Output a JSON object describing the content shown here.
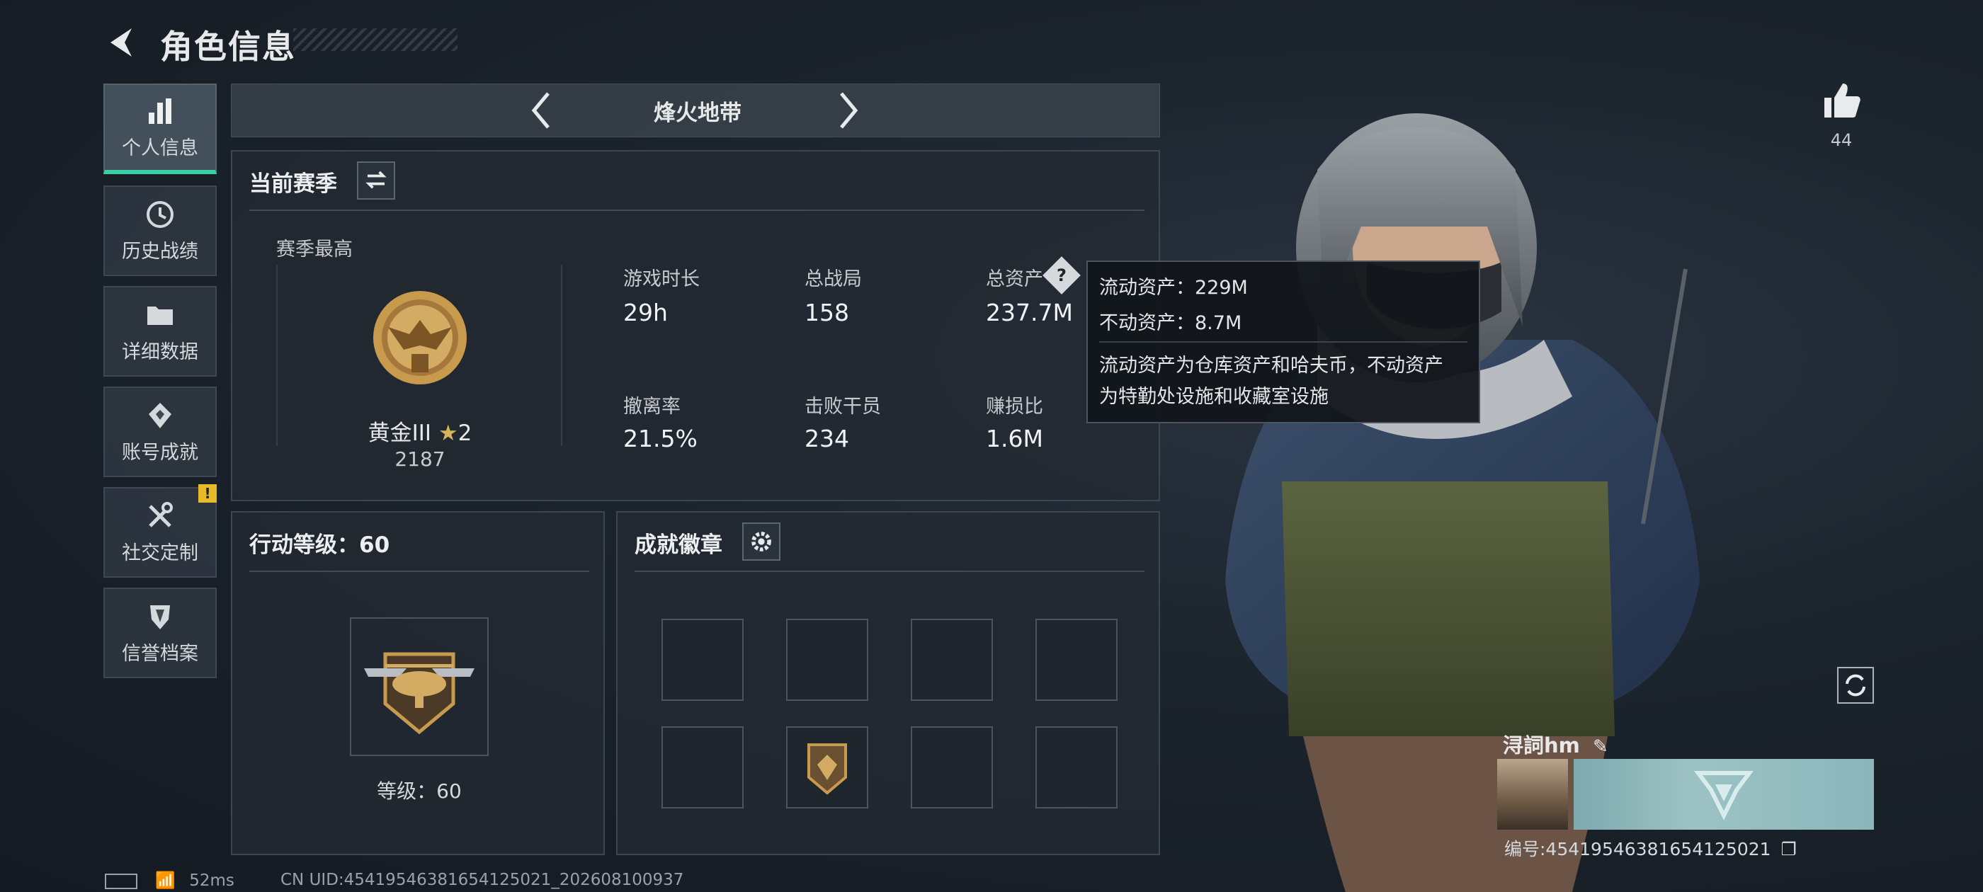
{
  "header": {
    "title": "角色信息"
  },
  "sidebar": {
    "items": [
      {
        "label": "个人信息",
        "icon": "bar-chart-icon",
        "active": true
      },
      {
        "label": "历史战绩",
        "icon": "history-icon"
      },
      {
        "label": "详细数据",
        "icon": "folder-icon"
      },
      {
        "label": "账号成就",
        "icon": "achievement-icon"
      },
      {
        "label": "社交定制",
        "icon": "tools-icon",
        "alert": "!"
      },
      {
        "label": "信誉档案",
        "icon": "shield-icon"
      }
    ]
  },
  "mode_tab": {
    "title": "烽火地带"
  },
  "season": {
    "title": "当前赛季",
    "best_label": "赛季最高",
    "rank": "黄金III",
    "rank_stars": "2",
    "rank_score": "2187",
    "stats": [
      {
        "label": "游戏时长",
        "value": "29h"
      },
      {
        "label": "总战局",
        "value": "158"
      },
      {
        "label": "总资产",
        "value": "237.7M"
      },
      {
        "label": "撤离率",
        "value": "21.5%"
      },
      {
        "label": "击败干员",
        "value": "234"
      },
      {
        "label": "赚损比",
        "value": "1.6M"
      }
    ]
  },
  "tooltip": {
    "line1": "流动资产：229M",
    "line2": "不动资产：8.7M",
    "desc1": "流动资产为仓库资产和哈夫币，不动资产",
    "desc2": "为特勤处设施和收藏室设施"
  },
  "action_level": {
    "title": "行动等级：60",
    "level_text": "等级：60"
  },
  "badges": {
    "title": "成就徽章"
  },
  "profile": {
    "likes": "44",
    "name": "浔詞hm",
    "id": "编号:45419546381654125021"
  },
  "status": {
    "ping": "52ms",
    "uid": "CN UID:45419546381654125021_202608100937"
  },
  "colors": {
    "accent": "#39d0a6",
    "alert": "#e8b92a",
    "gold": "#c89a4e"
  }
}
